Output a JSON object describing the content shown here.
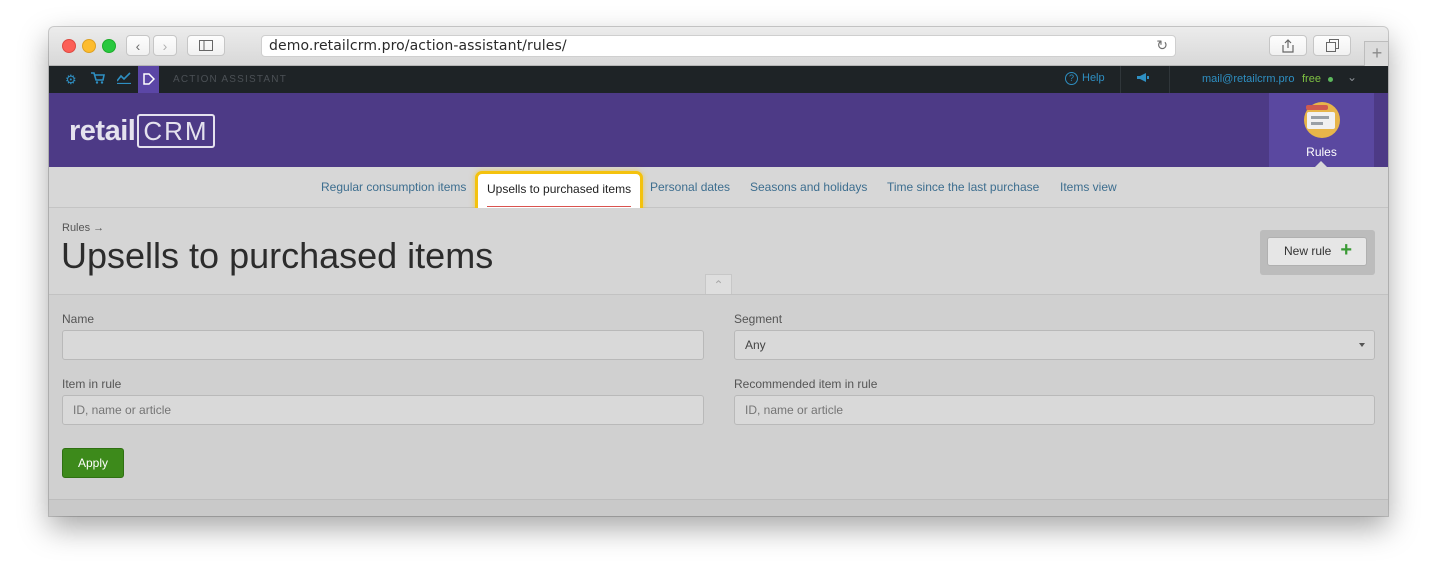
{
  "browser": {
    "url": "demo.retailcrm.pro/action-assistant/rules/"
  },
  "topbar": {
    "module": "ACTION ASSISTANT",
    "help": "Help",
    "email": "mail@retailcrm.pro",
    "plan": "free"
  },
  "header": {
    "logo_text": "retail",
    "logo_mark": "CRM",
    "tile_label": "Rules"
  },
  "subnav": {
    "items": [
      "Regular consumption items",
      "Upsells to purchased items",
      "Personal dates",
      "Seasons and holidays",
      "Time since the last purchase",
      "Items view"
    ],
    "active": "Upsells to purchased items"
  },
  "page": {
    "breadcrumb": "Rules →",
    "title": "Upsells to purchased items",
    "new_rule": "New rule"
  },
  "filters": {
    "name_label": "Name",
    "name_value": "",
    "segment_label": "Segment",
    "segment_value": "Any",
    "item_label": "Item in rule",
    "item_placeholder": "ID, name or article",
    "recommended_label": "Recommended item in rule",
    "recommended_placeholder": "ID, name or article",
    "apply": "Apply"
  },
  "colors": {
    "brand_purple": "#4d3a86",
    "apply_green": "#3d8a1b",
    "highlight": "#f4c20d",
    "link": "#3d6e8f"
  }
}
